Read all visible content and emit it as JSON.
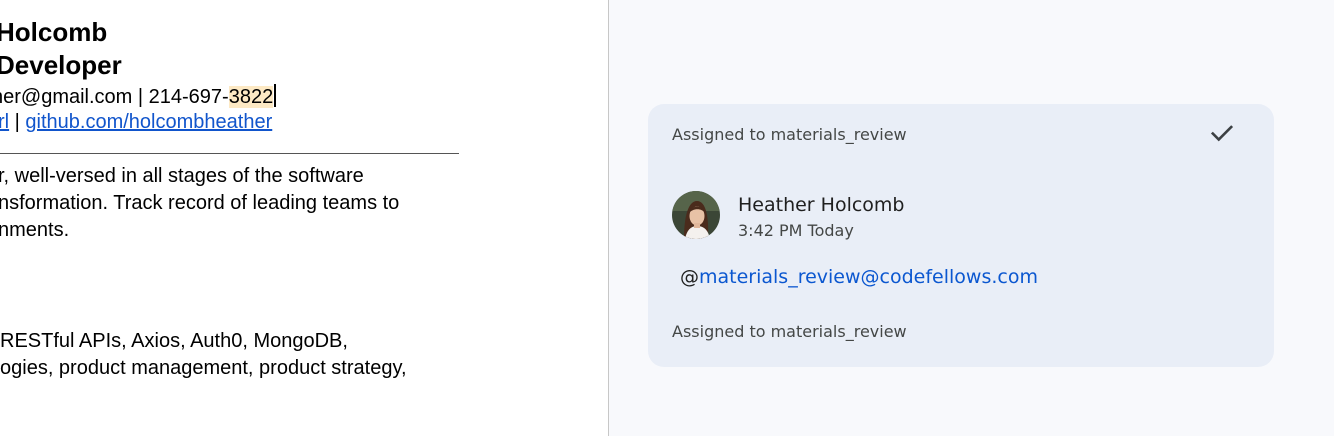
{
  "document": {
    "name": "Holcomb",
    "title": "Developer",
    "contact_prefix": "her@gmail.com | 214-697-",
    "contact_highlight": "3822",
    "link_1": "rl",
    "link_separator": " | ",
    "link_2": "github.com/holcombheather",
    "summary_lines": [
      "r, well-versed in all stages of the software",
      "nsformation. Track record of leading teams to",
      "nments."
    ],
    "skills_lines": [
      "RESTful APIs, Axios, Auth0, MongoDB,",
      "ogies, product management, product strategy,"
    ],
    "colors": {
      "link": "#1155cc",
      "highlight": "#fde9c4"
    }
  },
  "comment": {
    "assignment_header": "Assigned to materials_review",
    "resolve_icon": "check-icon",
    "author": "Heather Holcomb",
    "timestamp": "3:42 PM Today",
    "mention_at": "@",
    "mention_email": "materials_review@codefellows.com",
    "assignment_footer": "Assigned to materials_review",
    "colors": {
      "card": "#e9eef7",
      "mention": "#0b57d0",
      "panel": "#f8f9fc"
    }
  }
}
